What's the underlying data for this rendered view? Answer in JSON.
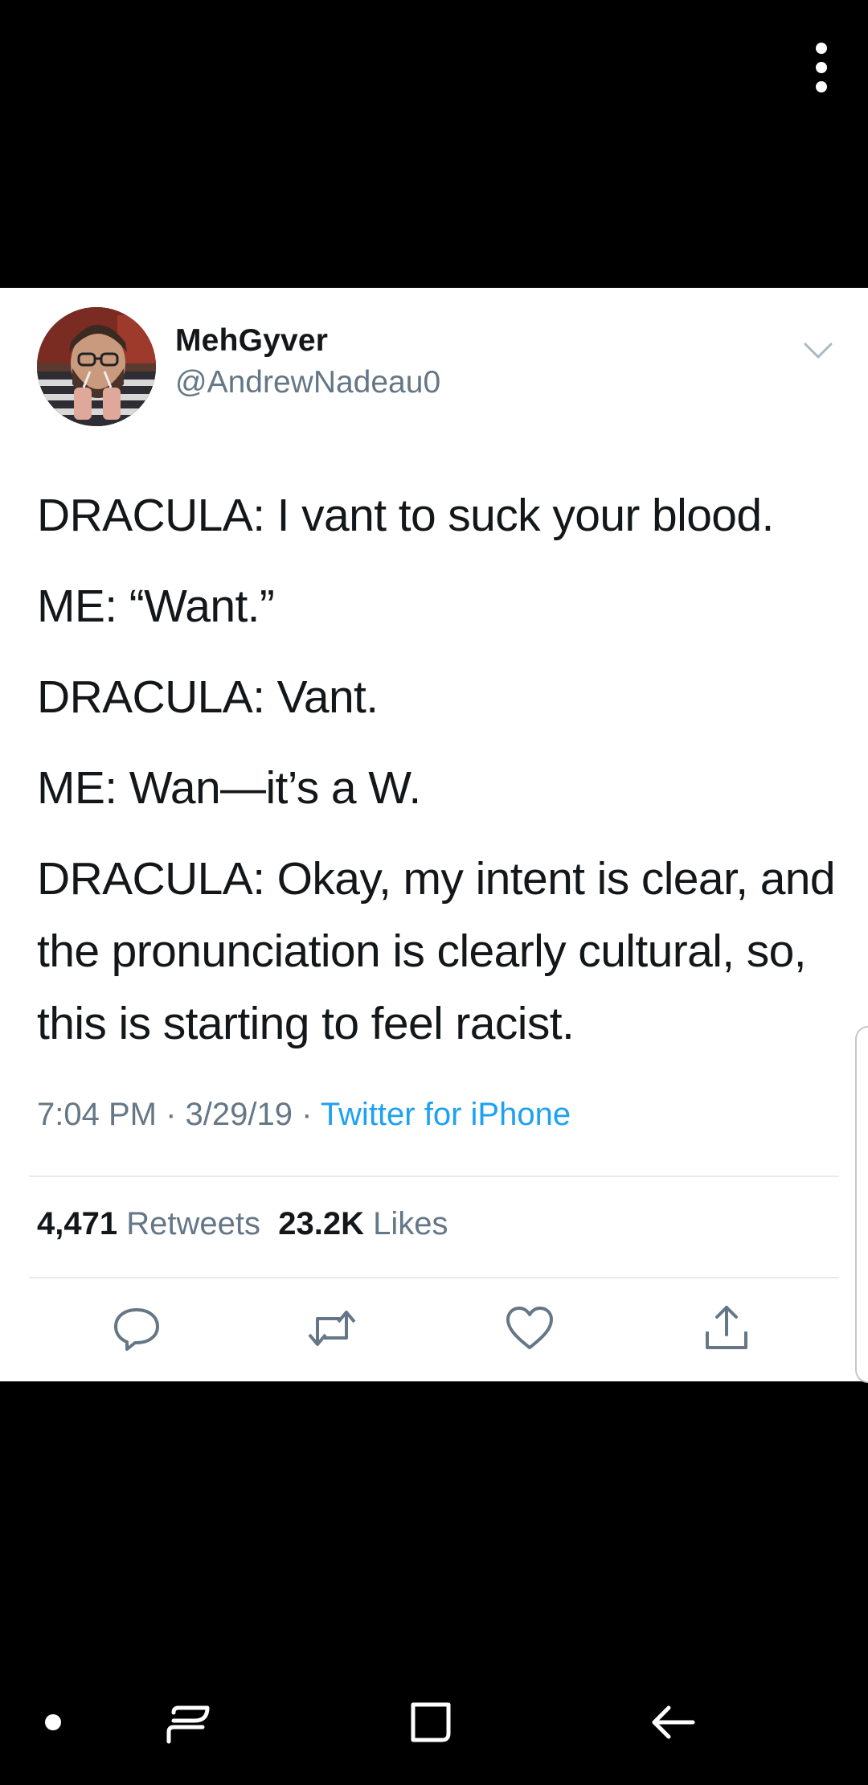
{
  "top_bar": {
    "menu_icon": "more-vertical-icon"
  },
  "tweet": {
    "author": {
      "display_name": "MehGyver",
      "handle": "@AndrewNadeau0"
    },
    "caret_icon": "chevron-down-icon",
    "lines": [
      "DRACULA: I vant to suck your blood.",
      "ME: “Want.”",
      "DRACULA: Vant.",
      "ME: Wan—it’s a W.",
      "DRACULA: Okay, my intent is clear, and the pronunciation is clearly cultural, so, this is starting to feel racist."
    ],
    "time": "7:04 PM",
    "separator": " · ",
    "date": "3/29/19",
    "source": "Twitter for iPhone",
    "retweets_count": "4,471",
    "retweets_label": "Retweets",
    "likes_count": "23.2K",
    "likes_label": "Likes",
    "actions": [
      "reply-icon",
      "retweet-icon",
      "like-icon",
      "share-icon"
    ]
  },
  "colors": {
    "accent": "#1da1f2",
    "secondary_text": "#657786",
    "primary_text": "#14171a",
    "background": "#000000",
    "card": "#ffffff"
  },
  "nav_bar": {
    "items": [
      "nav-dot-icon",
      "recents-icon",
      "home-icon",
      "back-icon"
    ]
  }
}
